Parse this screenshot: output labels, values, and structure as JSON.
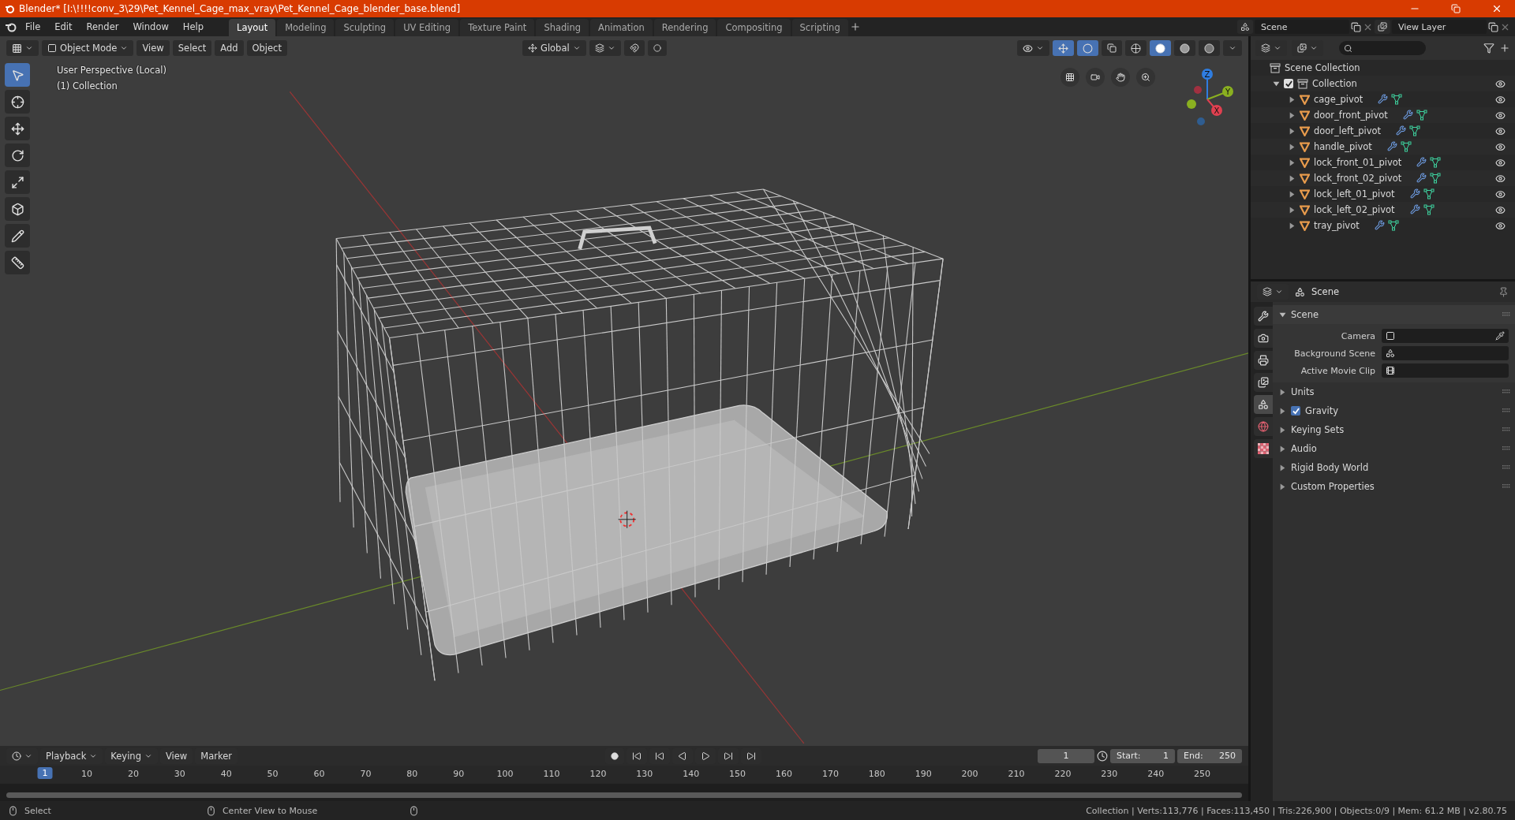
{
  "title_bar": {
    "title": "Blender* [I:\\!!!!conv_3\\29\\Pet_Kennel_Cage_max_vray\\Pet_Kennel_Cage_blender_base.blend]"
  },
  "menu": [
    "File",
    "Edit",
    "Render",
    "Window",
    "Help"
  ],
  "workspaces": [
    {
      "label": "Layout",
      "selected": true
    },
    {
      "label": "Modeling",
      "selected": false
    },
    {
      "label": "Sculpting",
      "selected": false
    },
    {
      "label": "UV Editing",
      "selected": false
    },
    {
      "label": "Texture Paint",
      "selected": false
    },
    {
      "label": "Shading",
      "selected": false
    },
    {
      "label": "Animation",
      "selected": false
    },
    {
      "label": "Rendering",
      "selected": false
    },
    {
      "label": "Compositing",
      "selected": false
    },
    {
      "label": "Scripting",
      "selected": false
    }
  ],
  "scene_selector": {
    "value": "Scene"
  },
  "view_layer": {
    "value": "View Layer"
  },
  "viewport_header": {
    "mode": "Object Mode",
    "menus": [
      "View",
      "Select",
      "Add",
      "Object"
    ],
    "orientation": "Global",
    "shading": [
      {
        "kind": "wireframe",
        "selected": false
      },
      {
        "kind": "solid",
        "selected": true
      },
      {
        "kind": "material",
        "selected": false
      },
      {
        "kind": "rendered",
        "selected": false
      }
    ]
  },
  "tools": [
    {
      "kind": "select",
      "selected": true
    },
    {
      "kind": "cursor",
      "selected": false
    },
    {
      "kind": "move",
      "selected": false
    },
    {
      "kind": "rotate",
      "selected": false
    },
    {
      "kind": "scale",
      "selected": false
    },
    {
      "kind": "transform",
      "selected": false
    },
    {
      "kind": "annotate",
      "selected": false
    },
    {
      "kind": "measure",
      "selected": false
    }
  ],
  "viewport": {
    "perspective": "User Perspective (Local)",
    "collection": "(1) Collection",
    "gizmo": {
      "x": "X",
      "y": "Y",
      "z": "Z"
    }
  },
  "outliner": {
    "root": "Scene Collection",
    "collection": {
      "name": "Collection",
      "checked": true,
      "expanded": true,
      "children": [
        {
          "name": "cage_pivot"
        },
        {
          "name": "door_front_pivot"
        },
        {
          "name": "door_left_pivot"
        },
        {
          "name": "handle_pivot"
        },
        {
          "name": "lock_front_01_pivot"
        },
        {
          "name": "lock_front_02_pivot"
        },
        {
          "name": "lock_left_01_pivot"
        },
        {
          "name": "lock_left_02_pivot"
        },
        {
          "name": "tray_pivot"
        }
      ]
    }
  },
  "properties": {
    "context": "Scene",
    "tabs": [
      {
        "kind": "tool",
        "selected": false
      },
      {
        "kind": "render",
        "selected": false
      },
      {
        "kind": "output",
        "selected": false
      },
      {
        "kind": "view_layer",
        "selected": false
      },
      {
        "kind": "scene",
        "selected": true
      },
      {
        "kind": "world",
        "selected": false
      },
      {
        "kind": "texture",
        "selected": false
      }
    ],
    "panels": [
      {
        "title": "Scene",
        "kind": "plain",
        "expanded": true,
        "fields": [
          {
            "label": "Camera",
            "kind": "camera"
          },
          {
            "label": "Background Scene",
            "kind": "scene"
          },
          {
            "label": "Active Movie Clip",
            "kind": "clip"
          }
        ]
      },
      {
        "title": "Units",
        "kind": "plain",
        "expanded": false
      },
      {
        "title": "Gravity",
        "kind": "toggle",
        "checked": true,
        "expanded": false
      },
      {
        "title": "Keying Sets",
        "kind": "plain",
        "expanded": false
      },
      {
        "title": "Audio",
        "kind": "plain",
        "expanded": false
      },
      {
        "title": "Rigid Body World",
        "kind": "plain",
        "expanded": false
      },
      {
        "title": "Custom Properties",
        "kind": "plain",
        "expanded": false
      }
    ]
  },
  "timeline": {
    "menus": [
      "Playback",
      "Keying",
      "View",
      "Marker"
    ],
    "current_frame": "1",
    "start_label": "Start:",
    "start": "1",
    "end_label": "End:",
    "end": "250",
    "playhead": "1",
    "ruler": [
      "10",
      "20",
      "30",
      "40",
      "50",
      "60",
      "70",
      "80",
      "90",
      "100",
      "110",
      "120",
      "130",
      "140",
      "150",
      "160",
      "170",
      "180",
      "190",
      "200",
      "210",
      "220",
      "230",
      "240",
      "250"
    ]
  },
  "status_bar": {
    "hints": [
      "Select",
      "Center View to Mouse"
    ],
    "stats": "Collection | Verts:113,776 | Faces:113,450 | Tris:226,900 | Objects:0/9 | Mem: 61.2 MB | v2.80.75"
  }
}
